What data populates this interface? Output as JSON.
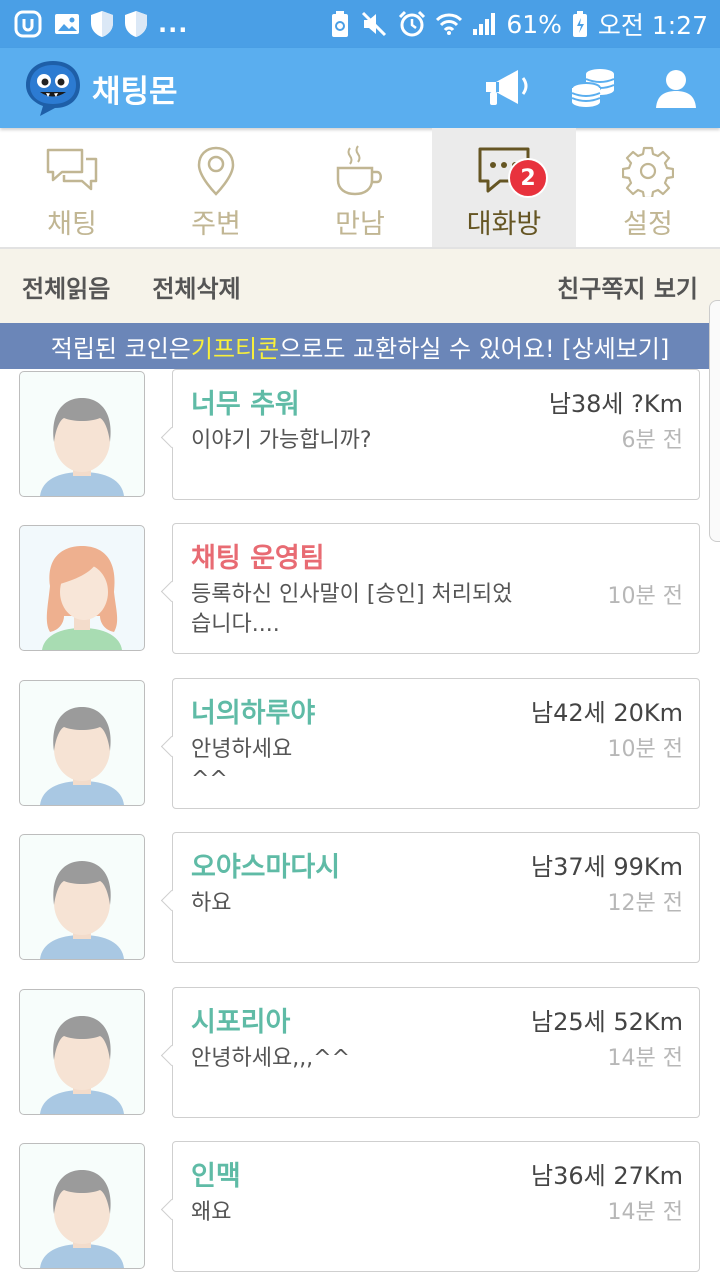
{
  "status_bar": {
    "battery": "61%",
    "time": "오전 1:27",
    "overflow": "..."
  },
  "app": {
    "title": "채팅몬"
  },
  "tabs": [
    {
      "label": "채팅",
      "icon": "chat-bubbles-icon",
      "active": false
    },
    {
      "label": "주변",
      "icon": "location-pin-icon",
      "active": false
    },
    {
      "label": "만남",
      "icon": "coffee-cup-icon",
      "active": false
    },
    {
      "label": "대화방",
      "icon": "chat-room-icon",
      "active": true,
      "badge": "2"
    },
    {
      "label": "설정",
      "icon": "gear-icon",
      "active": false
    }
  ],
  "actions": {
    "read_all": "전체읽음",
    "delete_all": "전체삭제",
    "view_friend_notes": "친구쪽지 보기"
  },
  "banner": {
    "prefix": "적립된 코인은 ",
    "highlight": "기프티콘",
    "suffix": "으로도 교환하실 수 있어요! [상세보기]"
  },
  "conversations": [
    {
      "name": "너무 추워",
      "meta": "남38세 ?Km",
      "message": "이야기 가능합니까?",
      "time": "6분 전",
      "avatar": "male"
    },
    {
      "name": "채팅 운영팀",
      "meta": "",
      "message": "등록하신 인사말이 [승인] 처리되었습니다....",
      "time": "10분 전",
      "avatar": "female"
    },
    {
      "name": "너의하루야",
      "meta": "남42세 20Km",
      "message": "안녕하세요\n^^",
      "time": "10분 전",
      "avatar": "male"
    },
    {
      "name": "오야스마다시",
      "meta": "남37세 99Km",
      "message": "하요",
      "time": "12분 전",
      "avatar": "male"
    },
    {
      "name": "시포리아",
      "meta": "남25세 52Km",
      "message": "안녕하세요,,,^^",
      "time": "14분 전",
      "avatar": "male"
    },
    {
      "name": "인맥",
      "meta": "남36세 27Km",
      "message": "왜요",
      "time": "14분 전",
      "avatar": "male"
    }
  ],
  "colors": {
    "status_bar": "#4a9fe6",
    "app_bar": "#5aaeef",
    "banner": "#6b86b8",
    "banner_highlight": "#f7ef3a",
    "name_user": "#5fbba6",
    "name_staff": "#e86b73",
    "badge": "#e8323d"
  }
}
